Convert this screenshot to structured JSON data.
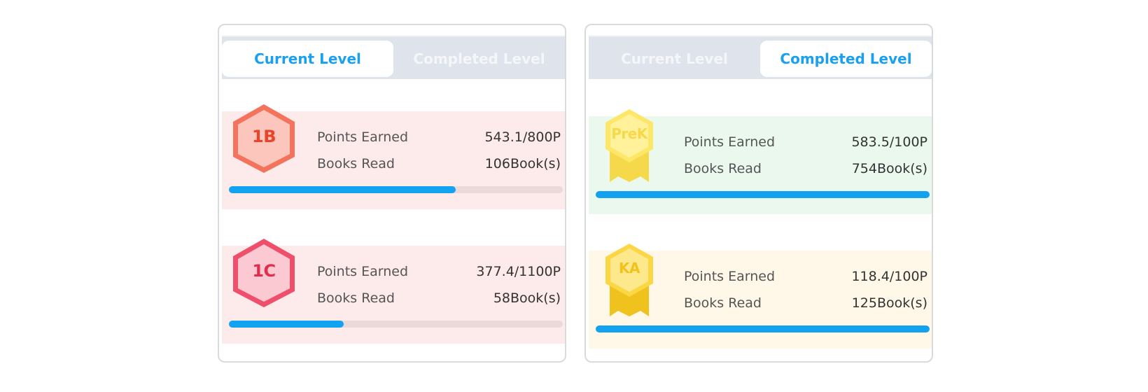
{
  "panels": [
    {
      "tabs": [
        {
          "label": "Current Level",
          "active": true
        },
        {
          "label": "Completed Level",
          "active": false
        }
      ],
      "cards": [
        {
          "level": "1B",
          "points_label": "Points Earned",
          "points_value": "543.1/800P",
          "books_label": "Books Read",
          "books_value": "106Book(s)",
          "progress": 0.679,
          "bg": "#fdeaea",
          "badge_color": "#f4735c",
          "badge_text_color": "#e8432b",
          "badge_inner": "#fcc6bc"
        },
        {
          "level": "1C",
          "points_label": "Points Earned",
          "points_value": "377.4/1100P",
          "books_label": "Books Read",
          "books_value": "58Book(s)",
          "progress": 0.343,
          "bg": "#fdeaea",
          "badge_color": "#ef4f6a",
          "badge_text_color": "#e12e4c",
          "badge_inner": "#fbc9d2"
        }
      ]
    },
    {
      "tabs": [
        {
          "label": "Current Level",
          "active": false
        },
        {
          "label": "Completed Level",
          "active": true
        }
      ],
      "cards": [
        {
          "level": "PreK",
          "points_label": "Points Earned",
          "points_value": "583.5/100P",
          "books_label": "Books Read",
          "books_value": "754Book(s)",
          "progress": 1.0,
          "bg": "#eaf8ee",
          "badge_color": "#fde668",
          "badge_text_color": "#f6d94a",
          "badge_inner": "#fff29a"
        },
        {
          "level": "KA",
          "points_label": "Points Earned",
          "points_value": "118.4/100P",
          "books_label": "Books Read",
          "books_value": "125Book(s)",
          "progress": 1.0,
          "bg": "#fff8e8",
          "badge_color": "#fbd745",
          "badge_text_color": "#f0c21d",
          "badge_inner": "#fde88b"
        }
      ]
    }
  ],
  "colors": {
    "accent": "#1aa0ee",
    "bar_fill": "#12a2f0",
    "tab_inactive_bg": "#dfe3eb"
  }
}
